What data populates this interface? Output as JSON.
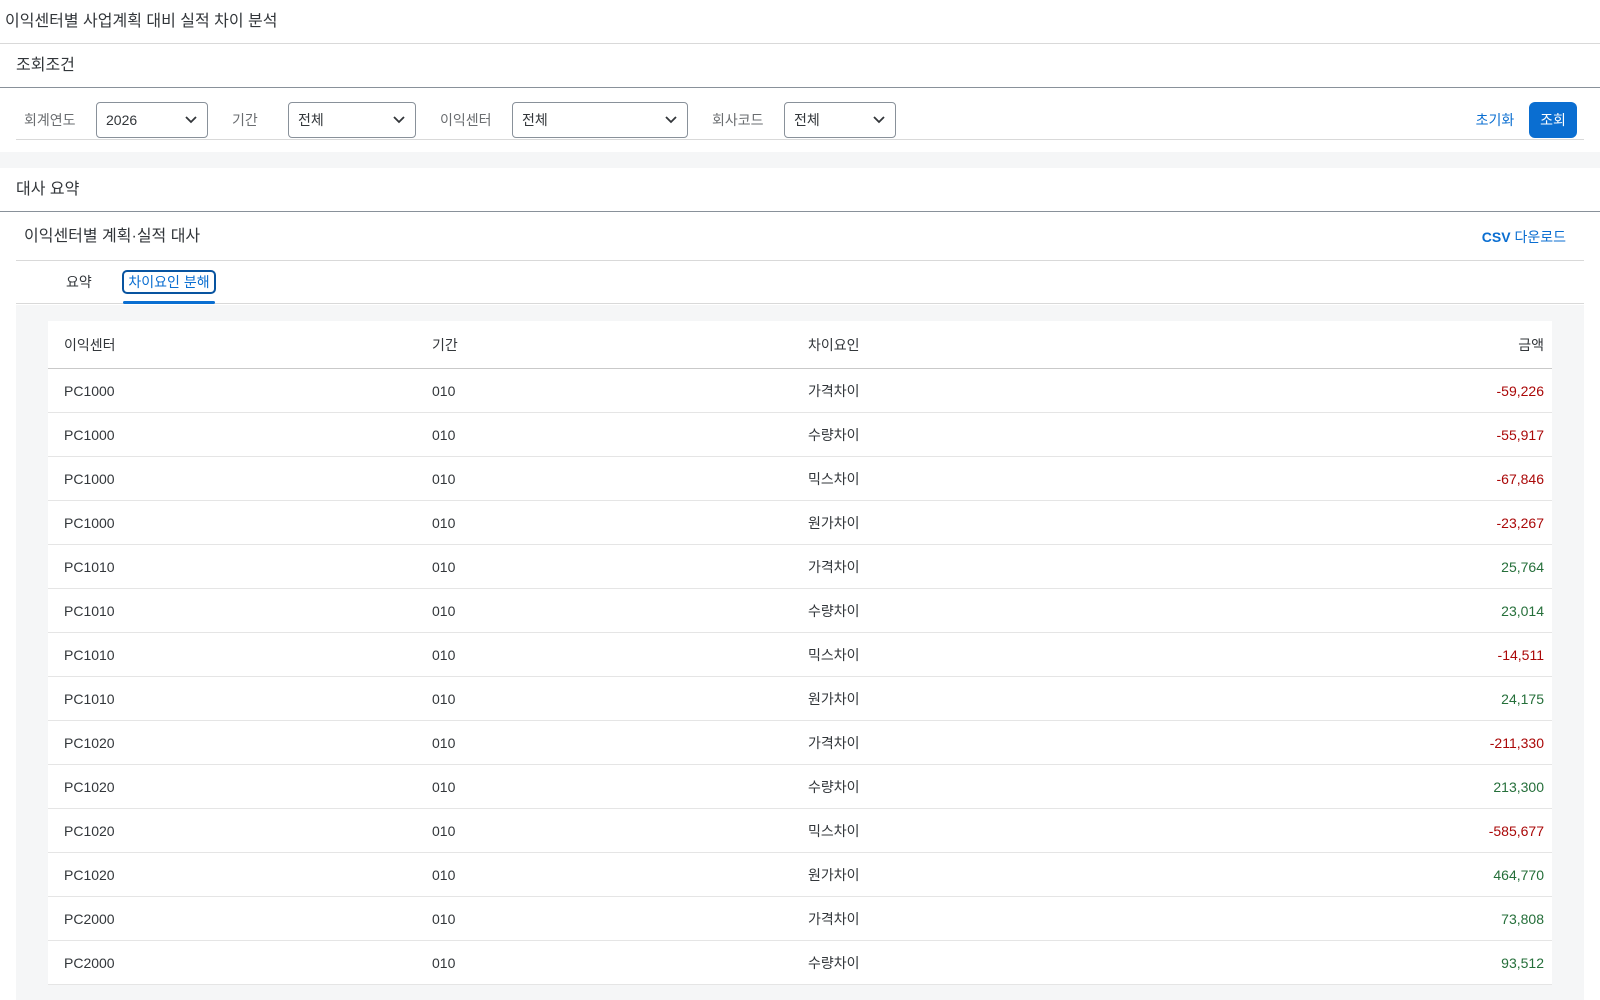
{
  "page_title": "이익센터별 사업계획 대비 실적 차이 분석",
  "filter_panel": {
    "title": "조회조건",
    "fiscal_year": {
      "label": "회계연도",
      "value": "2026"
    },
    "period": {
      "label": "기간",
      "value": "전체"
    },
    "profit_center": {
      "label": "이익센터",
      "value": "전체"
    },
    "company_code": {
      "label": "회사코드",
      "value": "전체"
    },
    "reset_label": "초기화",
    "search_label": "조회"
  },
  "summary_panel": {
    "title": "대사 요약",
    "table_title": "이익센터별 계획·실적 대사",
    "csv_bold": "CSV",
    "csv_label": "다운로드",
    "tabs": [
      {
        "label": "요약",
        "active": false
      },
      {
        "label": "차이요인 분해",
        "active": true
      }
    ],
    "columns": [
      "이익센터",
      "기간",
      "차이요인",
      "금액"
    ],
    "rows": [
      {
        "pc": "PC1000",
        "period": "010",
        "factor": "가격차이",
        "amount": "-59,226",
        "sign": "neg"
      },
      {
        "pc": "PC1000",
        "period": "010",
        "factor": "수량차이",
        "amount": "-55,917",
        "sign": "neg"
      },
      {
        "pc": "PC1000",
        "period": "010",
        "factor": "믹스차이",
        "amount": "-67,846",
        "sign": "neg"
      },
      {
        "pc": "PC1000",
        "period": "010",
        "factor": "원가차이",
        "amount": "-23,267",
        "sign": "neg"
      },
      {
        "pc": "PC1010",
        "period": "010",
        "factor": "가격차이",
        "amount": "25,764",
        "sign": "pos"
      },
      {
        "pc": "PC1010",
        "period": "010",
        "factor": "수량차이",
        "amount": "23,014",
        "sign": "pos"
      },
      {
        "pc": "PC1010",
        "period": "010",
        "factor": "믹스차이",
        "amount": "-14,511",
        "sign": "neg"
      },
      {
        "pc": "PC1010",
        "period": "010",
        "factor": "원가차이",
        "amount": "24,175",
        "sign": "pos"
      },
      {
        "pc": "PC1020",
        "period": "010",
        "factor": "가격차이",
        "amount": "-211,330",
        "sign": "neg"
      },
      {
        "pc": "PC1020",
        "period": "010",
        "factor": "수량차이",
        "amount": "213,300",
        "sign": "pos"
      },
      {
        "pc": "PC1020",
        "period": "010",
        "factor": "믹스차이",
        "amount": "-585,677",
        "sign": "neg"
      },
      {
        "pc": "PC1020",
        "period": "010",
        "factor": "원가차이",
        "amount": "464,770",
        "sign": "pos"
      },
      {
        "pc": "PC2000",
        "period": "010",
        "factor": "가격차이",
        "amount": "73,808",
        "sign": "pos"
      },
      {
        "pc": "PC2000",
        "period": "010",
        "factor": "수량차이",
        "amount": "93,512",
        "sign": "pos"
      }
    ]
  },
  "colors": {
    "accent": "#0a6ed1",
    "negative": "#aa0808",
    "positive": "#256f3a"
  }
}
